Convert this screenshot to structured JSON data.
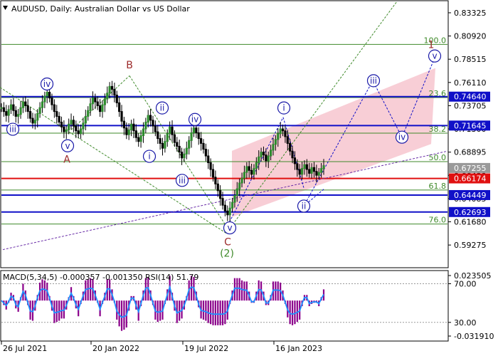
{
  "header": {
    "title": "AUDUSD, Daily:  Australian Dollar vs US Dollar"
  },
  "colors": {
    "fib_line": "#3f8a2a",
    "blue_level": "#1010c8",
    "red_level": "#e01010",
    "channel_fill": "#f7c6cf",
    "wave_blue": "#1a1aa8",
    "wave_red": "#9c2a2a",
    "macd_hist": "#8b008b",
    "macd_signal": "#1e90ff",
    "price_tag_gray": "#9a9a9a"
  },
  "chart_data": [
    {
      "type": "candlestick",
      "name": "price",
      "ylim": [
        0.57,
        0.845
      ],
      "x_ticks": [
        "26 Jul 2021",
        "20 Jan 2022",
        "19 Jul 2022",
        "16 Jan 2023"
      ],
      "y_ticks": [
        "0.83325",
        "0.80920",
        "0.78515",
        "0.76110",
        "0.73705",
        "0.71300",
        "0.68895",
        "0.66490",
        "0.64085",
        "0.61680",
        "0.59275"
      ],
      "price_tags": [
        {
          "label": "0.74640",
          "value": 0.7464,
          "color": "#1010c8"
        },
        {
          "label": "0.71645",
          "value": 0.71645,
          "color": "#1010c8"
        },
        {
          "label": "0.67255",
          "value": 0.67255,
          "color": "#9a9a9a"
        },
        {
          "label": "0.66174",
          "value": 0.66174,
          "color": "#e01010"
        },
        {
          "label": "0.64449",
          "value": 0.64449,
          "color": "#1010c8"
        },
        {
          "label": "0.62693",
          "value": 0.62693,
          "color": "#1010c8"
        }
      ],
      "fib_levels": [
        {
          "label": "100.0",
          "value": 0.8005
        },
        {
          "label": "23.6",
          "value": 0.7455
        },
        {
          "label": "38.2",
          "value": 0.7086
        },
        {
          "label": "50.0",
          "value": 0.6791
        },
        {
          "label": "61.8",
          "value": 0.6497
        },
        {
          "label": "76.0",
          "value": 0.6145
        }
      ],
      "h_levels": [
        {
          "value": 0.7464,
          "color": "#1010c8"
        },
        {
          "value": 0.71645,
          "color": "#1010c8"
        },
        {
          "value": 0.66174,
          "color": "#e01010"
        },
        {
          "value": 0.64449,
          "color": "#1010c8"
        },
        {
          "value": 0.62693,
          "color": "#1010c8"
        }
      ],
      "series_close": [
        0.735,
        0.731,
        0.727,
        0.733,
        0.738,
        0.732,
        0.726,
        0.728,
        0.735,
        0.741,
        0.737,
        0.731,
        0.724,
        0.719,
        0.722,
        0.729,
        0.735,
        0.741,
        0.747,
        0.751,
        0.745,
        0.738,
        0.731,
        0.726,
        0.72,
        0.715,
        0.71,
        0.712,
        0.718,
        0.722,
        0.716,
        0.711,
        0.708,
        0.713,
        0.719,
        0.726,
        0.732,
        0.739,
        0.745,
        0.741,
        0.737,
        0.731,
        0.738,
        0.744,
        0.75,
        0.757,
        0.754,
        0.748,
        0.74,
        0.731,
        0.721,
        0.714,
        0.707,
        0.712,
        0.718,
        0.711,
        0.704,
        0.7,
        0.706,
        0.713,
        0.72,
        0.727,
        0.722,
        0.716,
        0.71,
        0.703,
        0.698,
        0.693,
        0.7,
        0.708,
        0.715,
        0.707,
        0.699,
        0.695,
        0.689,
        0.683,
        0.687,
        0.693,
        0.701,
        0.709,
        0.714,
        0.709,
        0.703,
        0.698,
        0.692,
        0.685,
        0.678,
        0.671,
        0.663,
        0.656,
        0.649,
        0.641,
        0.634,
        0.628,
        0.624,
        0.631,
        0.637,
        0.644,
        0.651,
        0.657,
        0.662,
        0.668,
        0.674,
        0.67,
        0.666,
        0.672,
        0.678,
        0.684,
        0.689,
        0.686,
        0.68,
        0.685,
        0.691,
        0.697,
        0.702,
        0.708,
        0.713,
        0.711,
        0.705,
        0.698,
        0.69,
        0.683,
        0.677,
        0.671,
        0.666,
        0.672,
        0.676,
        0.671,
        0.667,
        0.673,
        0.669,
        0.665,
        0.668,
        0.672,
        0.675
      ],
      "waves": [
        {
          "label": "iii",
          "value": 0.7126,
          "style": "blue-circle"
        },
        {
          "label": "iv",
          "value": 0.7595,
          "style": "blue-circle"
        },
        {
          "label": "v",
          "value": 0.6955,
          "style": "blue-circle"
        },
        {
          "label": "A",
          "value": 0.6818,
          "style": "red"
        },
        {
          "label": "B",
          "value": 0.7792,
          "style": "red"
        },
        {
          "label": "i",
          "value": 0.6846,
          "style": "blue-circle"
        },
        {
          "label": "ii",
          "value": 0.7347,
          "style": "blue-circle"
        },
        {
          "label": "iii",
          "value": 0.6597,
          "style": "blue-circle"
        },
        {
          "label": "iv",
          "value": 0.7228,
          "style": "blue-circle"
        },
        {
          "label": "v",
          "value": 0.6105,
          "style": "blue-circle"
        },
        {
          "label": "C",
          "value": 0.5962,
          "style": "red"
        },
        {
          "label": "(2)",
          "value": 0.5845,
          "style": "green"
        },
        {
          "label": "i",
          "value": 0.7347,
          "style": "blue-circle"
        },
        {
          "label": "ii",
          "value": 0.6331,
          "style": "blue-circle"
        },
        {
          "label": "iii",
          "value": 0.7629,
          "style": "blue-circle"
        },
        {
          "label": "iv",
          "value": 0.7044,
          "style": "blue-circle"
        },
        {
          "label": "v",
          "value": 0.7885,
          "style": "blue-circle"
        },
        {
          "label": "1",
          "value": 0.8005,
          "style": "red"
        }
      ],
      "channel": [
        [
          0.6903,
          0.6217
        ],
        [
          0.776,
          0.6974
        ]
      ],
      "forecast_path": [
        0.6505,
        0.6331,
        0.7629,
        0.7044,
        0.7885
      ]
    },
    {
      "type": "bar",
      "name": "MACD / RSI",
      "label": "MACD(5,34,5) -0.000357 -0.001350 RSI(14) 51.79",
      "ylim": [
        -0.03191,
        0.023505
      ],
      "y_ticks": [
        "0.023505",
        "70.00",
        "30.00",
        "-0.031910"
      ]
    }
  ]
}
